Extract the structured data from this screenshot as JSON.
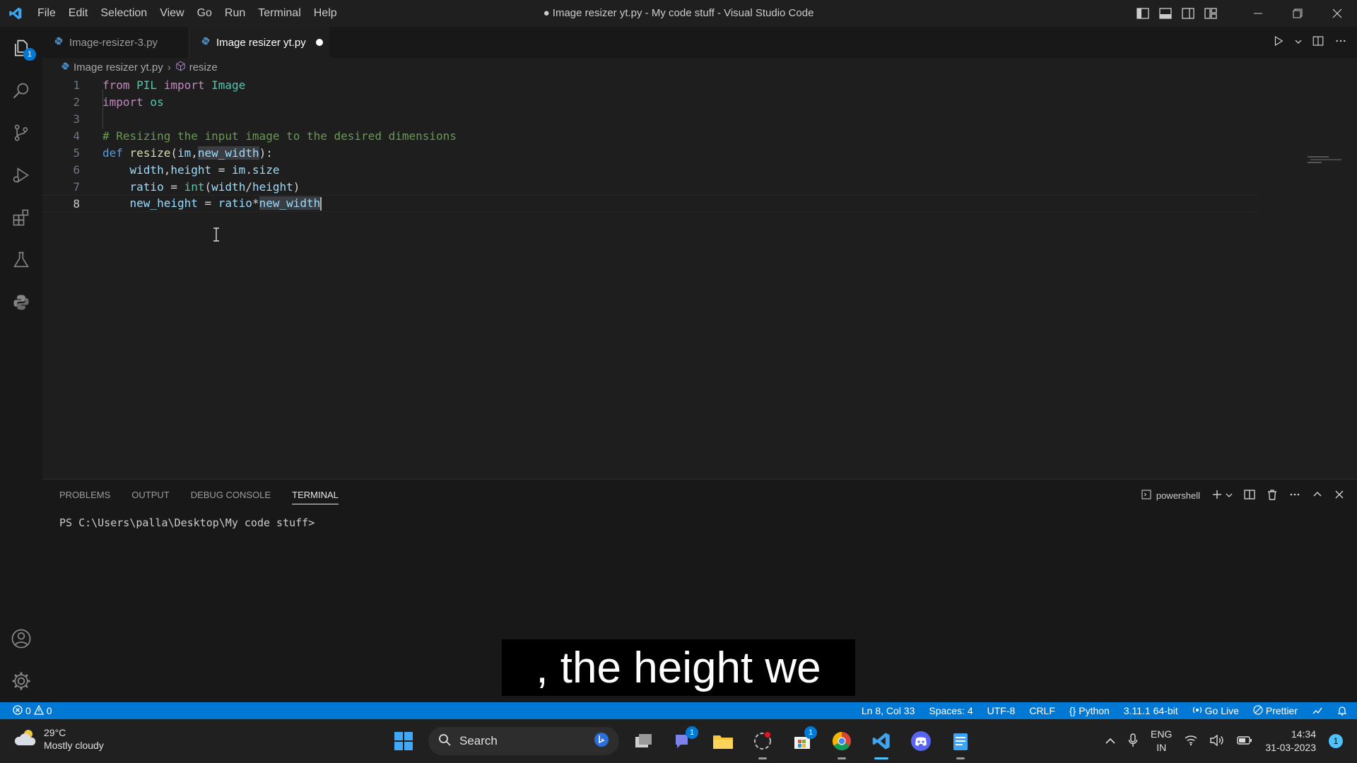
{
  "window": {
    "title": "● Image resizer yt.py - My code stuff - Visual Studio Code",
    "menu": [
      "File",
      "Edit",
      "Selection",
      "View",
      "Go",
      "Run",
      "Terminal",
      "Help"
    ]
  },
  "activity_bar": {
    "items": [
      "explorer-icon",
      "search-icon",
      "source-control-icon",
      "run-debug-icon",
      "extensions-icon",
      "testing-icon",
      "python-icon"
    ],
    "explorer_badge": "1",
    "bottom": [
      "accounts-icon",
      "manage-gear-icon"
    ]
  },
  "tabs": [
    {
      "label": "Image-resizer-3.py",
      "active": false
    },
    {
      "label": "Image resizer yt.py",
      "active": true,
      "dirty": true
    }
  ],
  "breadcrumb": {
    "file": "Image resizer yt.py",
    "symbol": "resize"
  },
  "editor": {
    "line_numbers": [
      "1",
      "2",
      "3",
      "4",
      "5",
      "6",
      "7",
      "8"
    ],
    "active_line": 8,
    "lines": [
      [
        "from",
        " PIL ",
        "import",
        " Image"
      ],
      [
        "import",
        " os"
      ],
      [],
      [
        "# Resizing the input image to the desired dimensions"
      ],
      [
        "def",
        " ",
        "resize",
        "(",
        "im",
        ",",
        "new_width",
        "):"
      ],
      [
        "    ",
        "width",
        ",",
        "height",
        " = ",
        "im",
        ".",
        "size"
      ],
      [
        "    ",
        "ratio",
        " = ",
        "int",
        "(",
        "width",
        "/",
        "height",
        ")"
      ],
      [
        "    ",
        "new_height",
        " = ",
        "ratio",
        "*",
        "new_width"
      ]
    ]
  },
  "panel": {
    "tabs": [
      "PROBLEMS",
      "OUTPUT",
      "DEBUG CONSOLE",
      "TERMINAL"
    ],
    "active_tab": "TERMINAL",
    "shell": "powershell",
    "prompt": "PS C:\\Users\\palla\\Desktop\\My code stuff>"
  },
  "caption": ", the height we",
  "status_bar": {
    "errors": "0",
    "warnings": "0",
    "position": "Ln 8, Col 33",
    "spaces": "Spaces: 4",
    "encoding": "UTF-8",
    "eol": "CRLF",
    "language": "Python",
    "interpreter": "3.11.1 64-bit",
    "go_live": "Go Live",
    "prettier": "Prettier"
  },
  "taskbar": {
    "weather_temp": "29°C",
    "weather_desc": "Mostly cloudy",
    "search_label": "Search",
    "teams_badge": "1",
    "store_badge": "1",
    "lang_line1": "ENG",
    "lang_line2": "IN",
    "time": "14:34",
    "date": "31-03-2023",
    "notification_count": "1"
  },
  "colors": {
    "accent": "#0078d4",
    "keyword": "#569cd6",
    "control_keyword": "#c586c0",
    "class": "#4ec9b0",
    "function": "#dcdcaa",
    "variable": "#9cdcfe",
    "comment": "#6a9955"
  }
}
